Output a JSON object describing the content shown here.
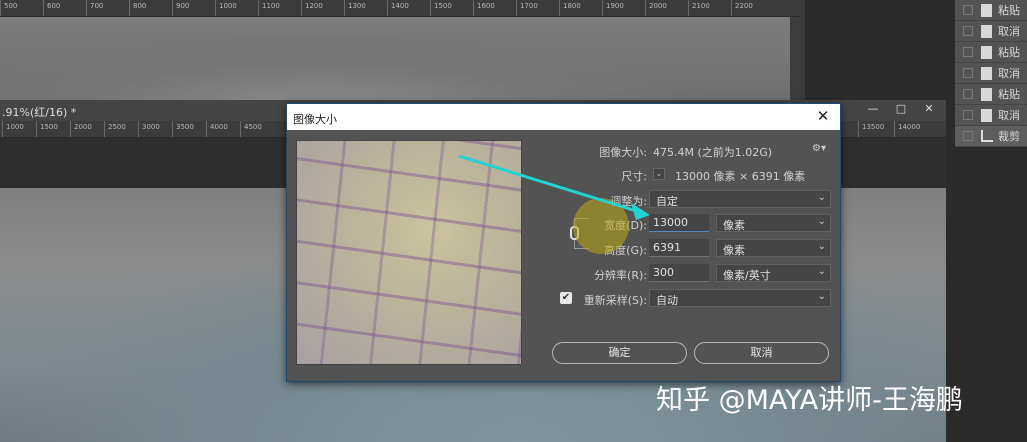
{
  "back_ruler": [
    "500",
    "600",
    "700",
    "800",
    "900",
    "1000",
    "1100",
    "1200",
    "1300",
    "1400",
    "1500",
    "1600",
    "1700",
    "1800",
    "1900",
    "2000",
    "2100",
    "2200"
  ],
  "history": {
    "items": [
      {
        "label": "粘贴"
      },
      {
        "label": "取消"
      },
      {
        "label": "粘贴"
      },
      {
        "label": "取消"
      },
      {
        "label": "粘贴"
      },
      {
        "label": "取消"
      },
      {
        "label": "裁剪"
      }
    ]
  },
  "document": {
    "tab_title": ".91%(红/16) *",
    "ruler": [
      "1000",
      "1500",
      "2000",
      "2500",
      "3000",
      "3500",
      "4000",
      "4500"
    ],
    "ruler_right": [
      "13500",
      "14000"
    ],
    "minimize": "—",
    "restore": "□",
    "close": "✕"
  },
  "dialog": {
    "title": "图像大小",
    "close": "✕",
    "image_size_label": "图像大小:",
    "image_size_value": "475.4M (之前为1.02G)",
    "dimensions_label": "尺寸:",
    "dimensions_value": "13000 像素  ×  6391 像素",
    "fit_to_label": "调整为:",
    "fit_to_value": "自定",
    "width_label": "宽度(D):",
    "width_value": "13000",
    "width_unit": "像素",
    "height_label": "高度(G):",
    "height_value": "6391",
    "height_unit": "像素",
    "resolution_label": "分辨率(R):",
    "resolution_value": "300",
    "resolution_unit": "像素/英寸",
    "resample_label": "重新采样(S):",
    "resample_value": "自动",
    "resample_checked": true,
    "ok_label": "确定",
    "cancel_label": "取消",
    "gear": "⚙▾"
  },
  "watermark": "知乎 @MAYA讲师-王海鹏",
  "colors": {
    "arrow": "#22d3d3",
    "highlight": "#bfa914",
    "dialog_border": "#1e4a73"
  }
}
